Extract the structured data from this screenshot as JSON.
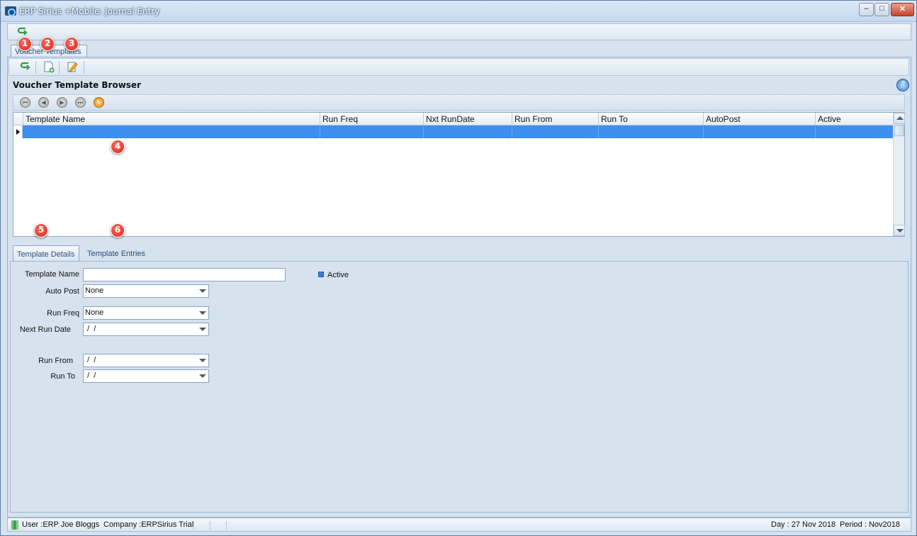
{
  "window": {
    "title": "ERP Sirius +Mobile: Journal Entry",
    "controls": {
      "minimize": "–",
      "maximize": "□",
      "close": "✕"
    }
  },
  "top_toolbar": {
    "refresh_icon": "green-refresh-arrow-icon"
  },
  "main_tab": {
    "label": "Voucher Templates"
  },
  "second_toolbar": {
    "buttons": [
      {
        "name": "refresh",
        "icon": "green-refresh-arrow-icon"
      },
      {
        "name": "new",
        "icon": "new-document-icon"
      },
      {
        "name": "edit",
        "icon": "edit-document-icon"
      }
    ]
  },
  "browser": {
    "title": "Voucher Template Browser",
    "nav_buttons": [
      "first",
      "previous",
      "next",
      "last",
      "refresh"
    ],
    "columns": [
      "Template Name",
      "Run Freq",
      "Nxt RunDate",
      "Run From",
      "Run To",
      "AutoPost",
      "Active"
    ],
    "rows": [
      [
        "",
        "",
        "",
        "",
        "",
        "",
        ""
      ]
    ]
  },
  "annotations": [
    "1",
    "2",
    "3",
    "4",
    "5",
    "6"
  ],
  "detail_tabs": [
    {
      "label": "Template Details",
      "active": true
    },
    {
      "label": "Template Entries",
      "active": false
    }
  ],
  "details_form": {
    "template_name_label": "Template Name",
    "template_name_value": "",
    "active_label": "Active",
    "auto_post_label": "Auto Post",
    "auto_post_value": "None",
    "run_freq_label": "Run Freq",
    "run_freq_value": "None",
    "next_run_date_label": "Next Run Date",
    "next_run_date_value": " /  /",
    "run_from_label": "Run From",
    "run_from_value": " /  /",
    "run_to_label": "Run To",
    "run_to_value": " /  /"
  },
  "statusbar": {
    "user": "User :ERP Joe Bloggs",
    "company": "Company :ERPSirius Trial",
    "day": "Day : 27 Nov 2018",
    "period": "Period : Nov2018"
  },
  "colors": {
    "selection": "#3d8ff0",
    "annotation": "#d9261a",
    "panel_bg": "#d6e2ee",
    "active_check": "#3b78d8"
  }
}
